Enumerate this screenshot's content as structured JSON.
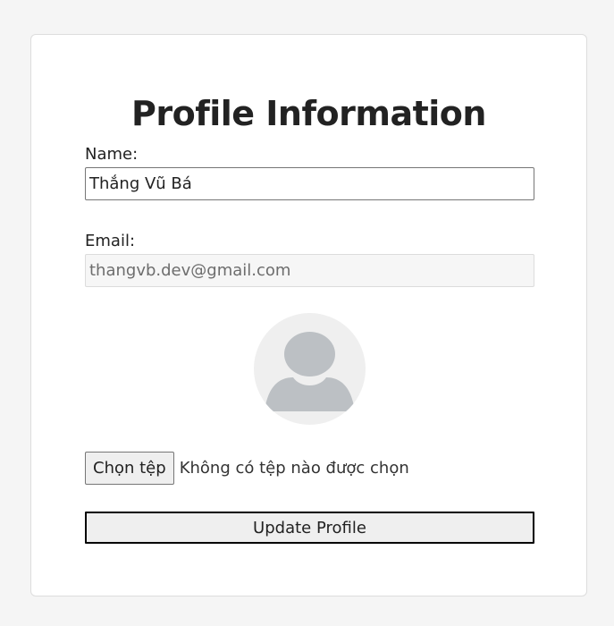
{
  "profile": {
    "title": "Profile Information",
    "name_label": "Name:",
    "name_value": "Thắng Vũ Bá",
    "email_label": "Email:",
    "email_value": "thangvb.dev@gmail.com",
    "avatar_icon": "user-silhouette-icon",
    "file_button_label": "Chọn tệp",
    "file_status": "Không có tệp nào được chọn",
    "update_button_label": "Update Profile"
  },
  "colors": {
    "background": "#f5f5f5",
    "card": "#ffffff",
    "avatar_bg": "#efefef",
    "avatar_fg": "#bcc0c4"
  }
}
